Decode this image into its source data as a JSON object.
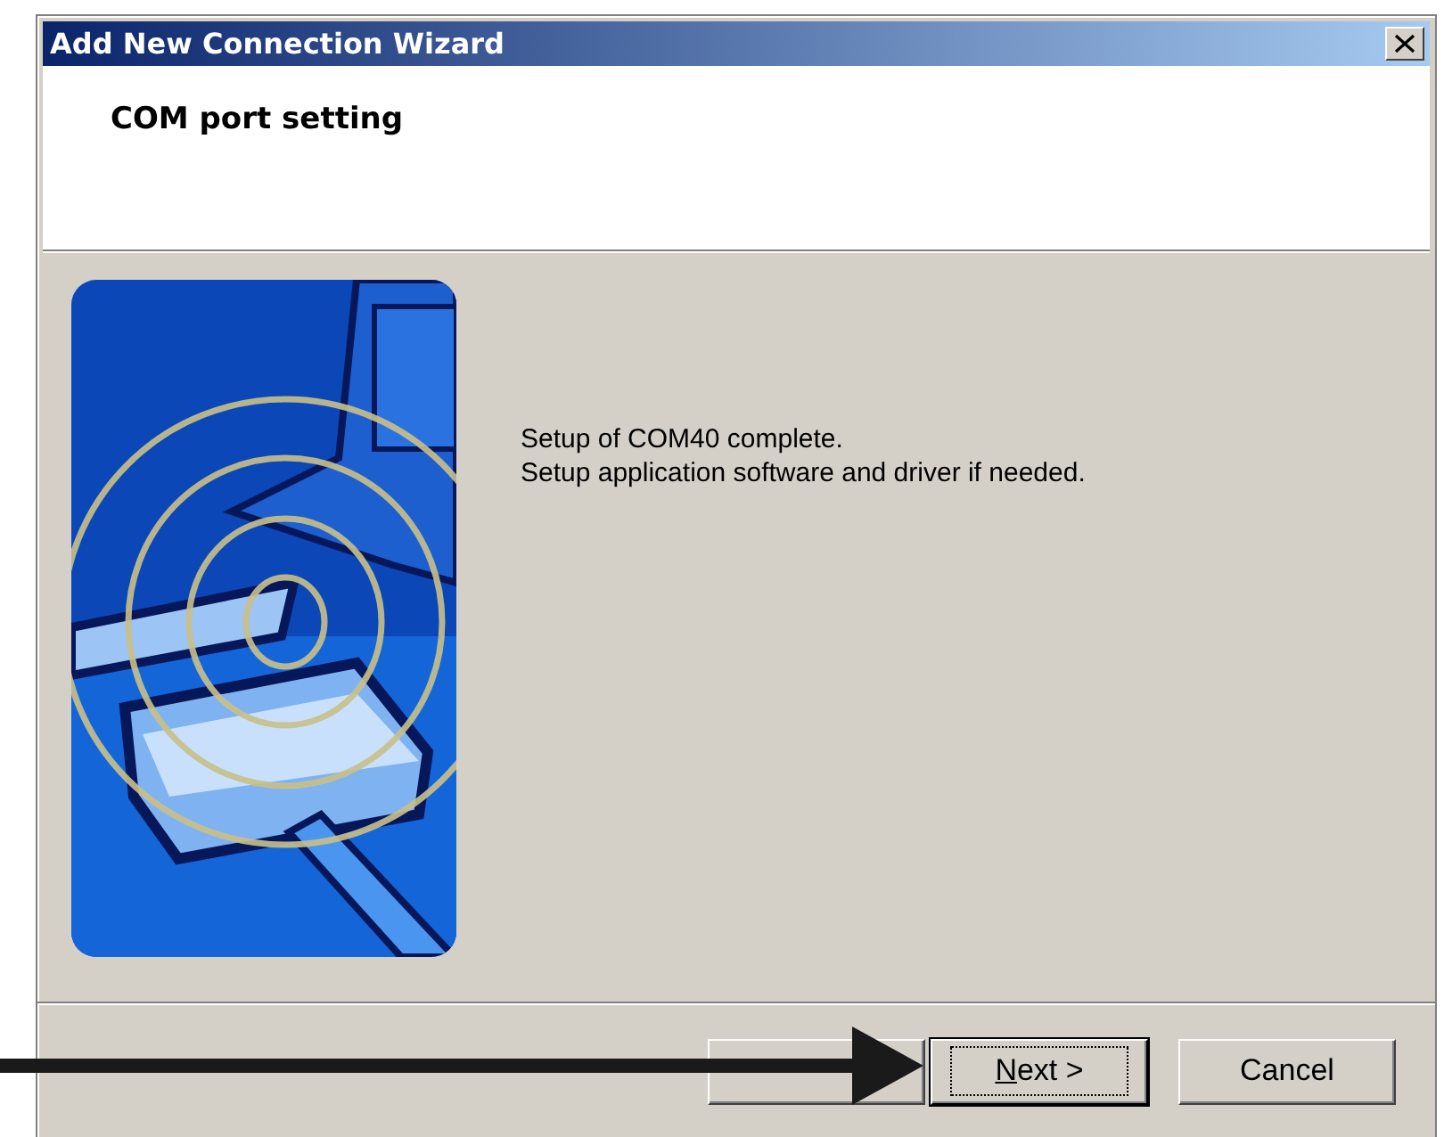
{
  "window": {
    "title": "Add New Connection Wizard"
  },
  "header": {
    "title": "COM port setting"
  },
  "message_lines": [
    "Setup of COM40 complete.",
    "Setup application software and driver if needed."
  ],
  "buttons": [
    {
      "focused": false
    },
    {
      "access_key": "N",
      "label_rest": "ext >",
      "focused": true
    },
    {
      "label_rest": "Cancel",
      "focused": false
    }
  ]
}
